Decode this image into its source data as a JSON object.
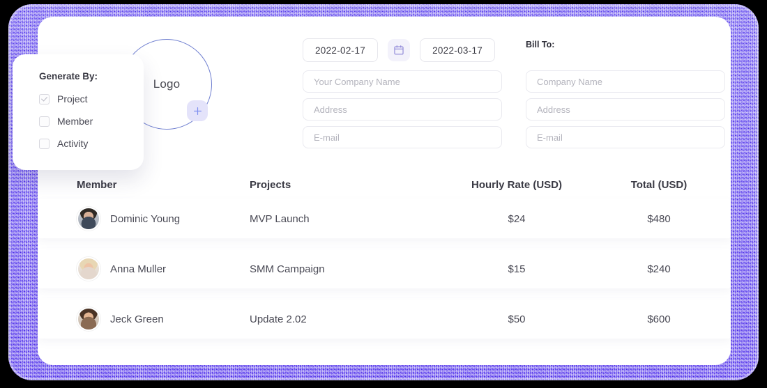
{
  "theme": {
    "frame_color": "#6a53ee",
    "accent": "#7b6cf0",
    "card_bg": "#ffffff",
    "text": "#4a4a55"
  },
  "logo": {
    "label": "Logo",
    "add_icon": "plus-icon"
  },
  "dates": {
    "start": "2022-02-17",
    "end": "2022-03-17",
    "calendar_icon": "calendar-icon"
  },
  "sender_form": {
    "fields": [
      {
        "name": "company",
        "placeholder": "Your Company Name",
        "value": ""
      },
      {
        "name": "address",
        "placeholder": "Address",
        "value": ""
      },
      {
        "name": "email",
        "placeholder": "E-mail",
        "value": ""
      }
    ]
  },
  "bill_to": {
    "title": "Bill To:",
    "fields": [
      {
        "name": "company",
        "placeholder": "Company Name",
        "value": ""
      },
      {
        "name": "address",
        "placeholder": "Address",
        "value": ""
      },
      {
        "name": "email",
        "placeholder": "E-mail",
        "value": ""
      }
    ]
  },
  "table": {
    "headers": {
      "member": "Member",
      "projects": "Projects",
      "rate": "Hourly Rate (USD)",
      "total": "Total (USD)"
    },
    "rows": [
      {
        "member": "Dominic Young",
        "project": "MVP Launch",
        "rate": "$24",
        "total": "$480"
      },
      {
        "member": "Anna Muller",
        "project": "SMM Campaign",
        "rate": "$15",
        "total": "$240"
      },
      {
        "member": "Jeck Green",
        "project": "Update 2.02",
        "rate": "$50",
        "total": "$600"
      }
    ]
  },
  "generate_by": {
    "title": "Generate By:",
    "options": [
      {
        "label": "Project",
        "checked": true
      },
      {
        "label": "Member",
        "checked": false
      },
      {
        "label": "Activity",
        "checked": false
      }
    ]
  }
}
